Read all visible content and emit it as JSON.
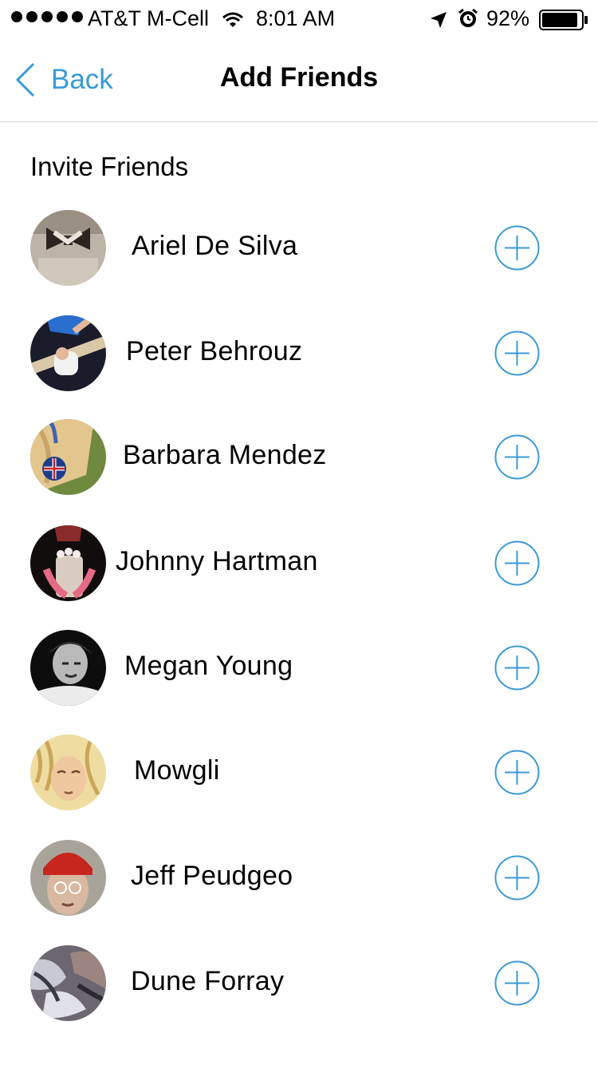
{
  "status_bar": {
    "carrier": "AT&T M-Cell",
    "time": "8:01 AM",
    "battery_percent": "92%",
    "battery_level": 0.92
  },
  "nav": {
    "back_label": "Back",
    "title": "Add Friends"
  },
  "section_title": "Invite Friends",
  "accent_color": "#3a9ad9",
  "friends": [
    {
      "name": "Ariel De Silva"
    },
    {
      "name": "Peter Behrouz"
    },
    {
      "name": "Barbara Mendez"
    },
    {
      "name": "Johnny Hartman"
    },
    {
      "name": "Megan Young"
    },
    {
      "name": "Mowgli"
    },
    {
      "name": "Jeff Peudgeo"
    },
    {
      "name": "Dune Forray"
    }
  ]
}
